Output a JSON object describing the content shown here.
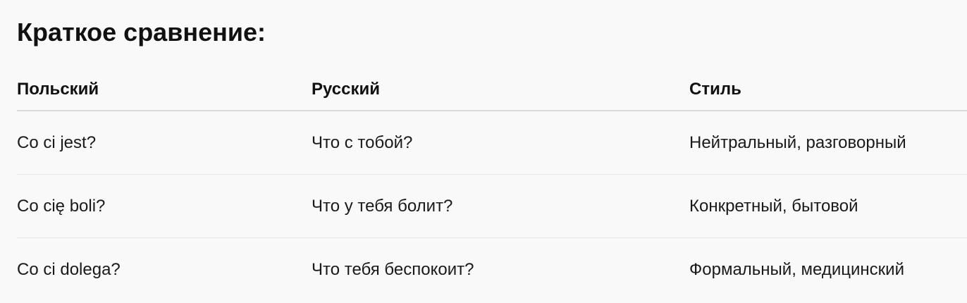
{
  "heading": "Краткое сравнение:",
  "table": {
    "headers": [
      "Польский",
      "Русский",
      "Стиль"
    ],
    "rows": [
      [
        "Co ci jest?",
        "Что с тобой?",
        "Нейтральный, разговорный"
      ],
      [
        "Co cię boli?",
        "Что у тебя болит?",
        "Конкретный, бытовой"
      ],
      [
        "Co ci dolega?",
        "Что тебя беспокоит?",
        "Формальный, медицинский"
      ]
    ]
  }
}
